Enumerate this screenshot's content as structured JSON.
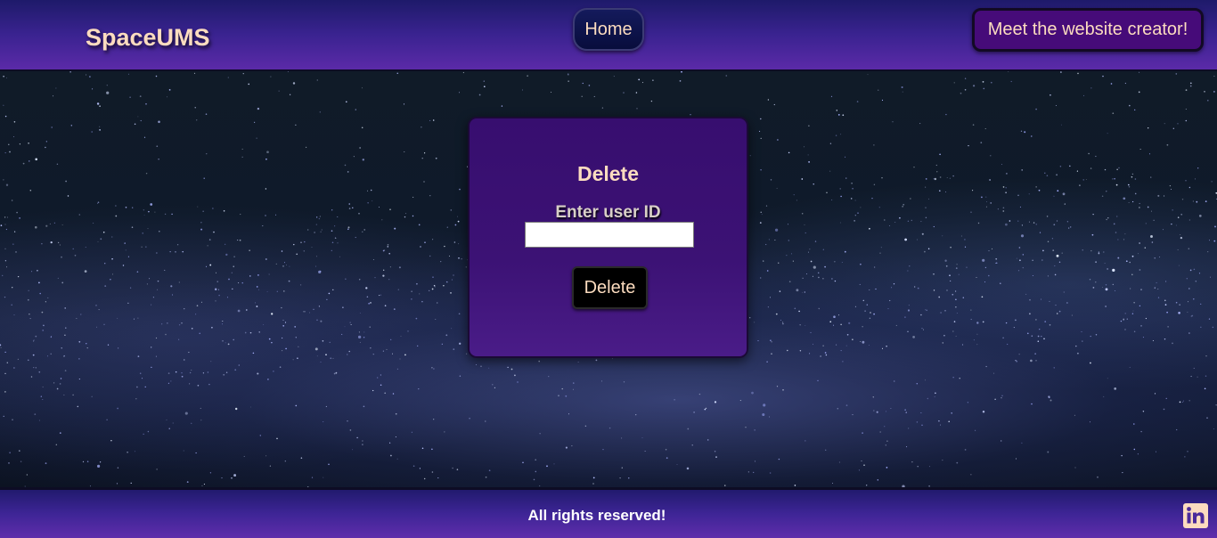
{
  "header": {
    "brand": "SpaceUMS",
    "home_label": "Home",
    "creator_label": "Meet the website creator!"
  },
  "card": {
    "title": "Delete",
    "input_label": "Enter user ID",
    "input_value": "",
    "button_label": "Delete"
  },
  "footer": {
    "text": "All rights reserved!",
    "social_icon": "linkedin-icon"
  },
  "colors": {
    "accent_text": "#fcdcbf",
    "header_gradient_top": "#1e1a6a",
    "header_gradient_bottom": "#5b2aa8",
    "card_background": "#3a1173",
    "creator_button": "#460b79"
  }
}
